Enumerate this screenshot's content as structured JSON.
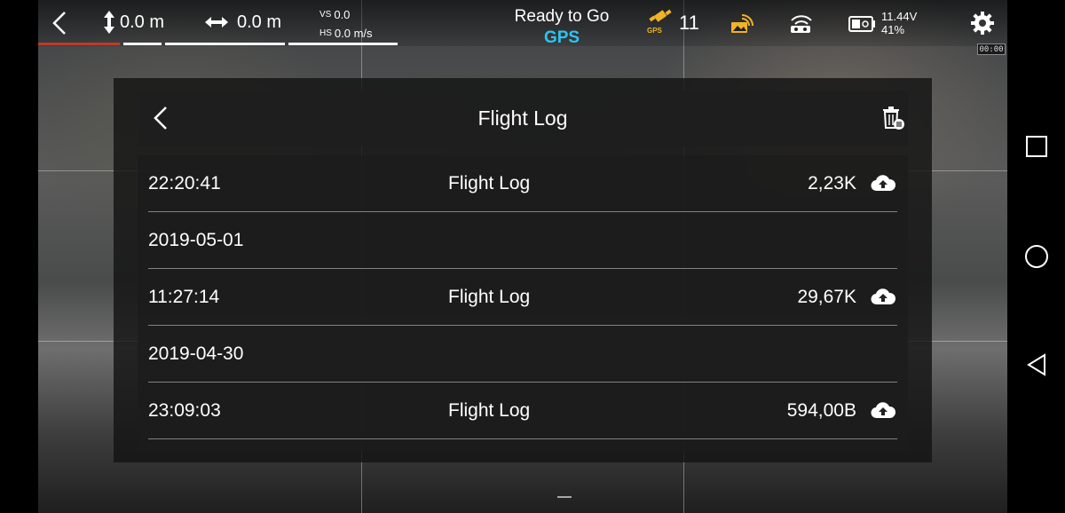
{
  "status": {
    "height_value": "0.0 m",
    "distance_value": "0.0 m",
    "vs_label": "VS",
    "vs_value": "0.0",
    "hs_label": "HS",
    "hs_value": "0.0 m/s",
    "ready_text": "Ready to Go",
    "mode_text": "GPS",
    "gps_badge": "GPS",
    "satellite_count": "11",
    "voltage": "11.44V",
    "battery_percent": "41%",
    "timer": "00:00",
    "colors": {
      "accent": "#2ec4f0",
      "gps_icon": "#f0b429",
      "battery_bar": "#c0392b"
    }
  },
  "dialog": {
    "title": "Flight Log",
    "rows": [
      {
        "time": "22:20:41",
        "name": "Flight Log",
        "size": "2,23K"
      },
      {
        "date": "2019-05-01"
      },
      {
        "time": "11:27:14",
        "name": "Flight Log",
        "size": "29,67K"
      },
      {
        "date": "2019-04-30"
      },
      {
        "time": "23:09:03",
        "name": "Flight Log",
        "size": "594,00B"
      }
    ]
  },
  "icons": [
    "back-icon",
    "altitude-icon",
    "distance-icon",
    "gps-satellite-icon",
    "image-transmission-icon",
    "remote-signal-icon",
    "battery-icon",
    "settings-icon",
    "delete-icon",
    "cloud-upload-icon",
    "square-icon",
    "circle-icon",
    "triangle-back-icon"
  ]
}
